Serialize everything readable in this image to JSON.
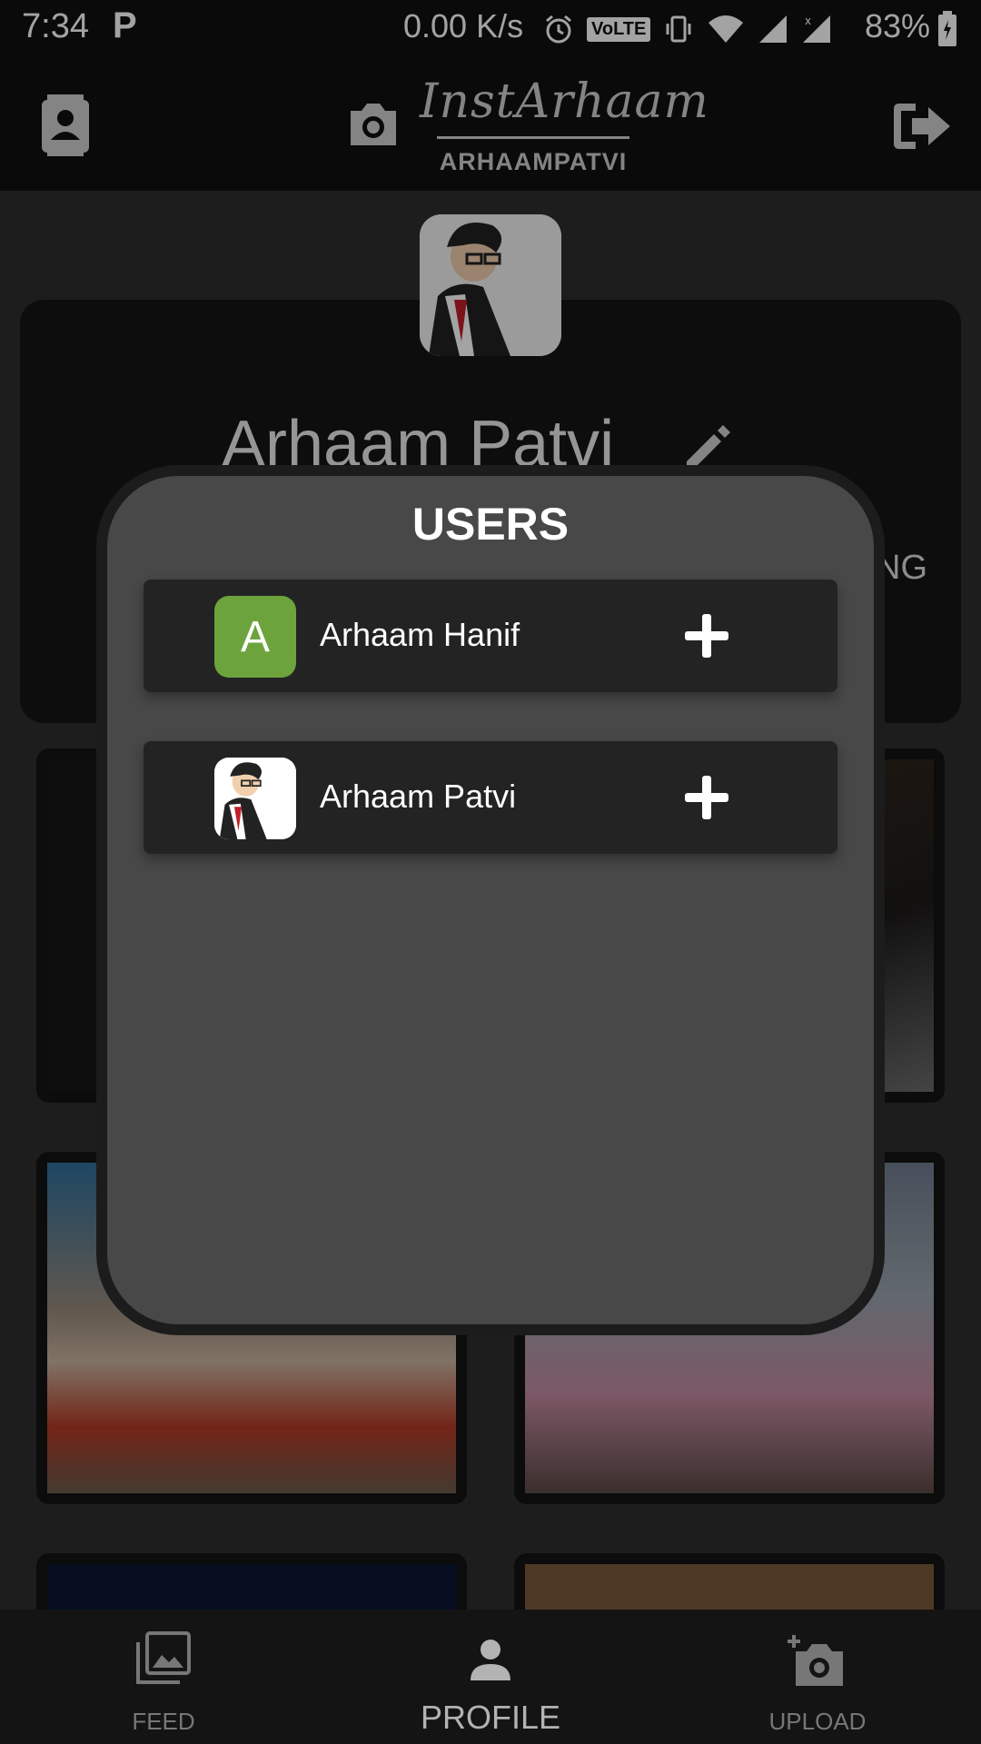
{
  "status_bar": {
    "time": "7:34",
    "notification_icon": "P",
    "net_speed": "0.00 K/s",
    "volte": "VoLTE",
    "battery": "83%",
    "icons": [
      "alarm-icon",
      "volte-icon",
      "vibrate-icon",
      "wifi-icon",
      "signal-icon",
      "signal-icon",
      "battery-icon"
    ]
  },
  "header": {
    "brand": "InstArhaam",
    "username": "ARHAAMPATVI"
  },
  "profile": {
    "name": "Arhaam Patvi",
    "partial_stat_label": "NG"
  },
  "dialog": {
    "title": "USERS",
    "users": [
      {
        "initial": "A",
        "name": "Arhaam Hanif",
        "avatar_color": "#6da33d"
      },
      {
        "initial": "",
        "name": "Arhaam Patvi",
        "avatar_color": "#ffffff"
      }
    ]
  },
  "bottom_nav": {
    "items": [
      {
        "label": "FEED",
        "icon": "image-gallery-icon"
      },
      {
        "label": "PROFILE",
        "icon": "person-icon"
      },
      {
        "label": "UPLOAD",
        "icon": "add-camera-icon"
      }
    ],
    "active": "PROFILE"
  },
  "colors": {
    "dialog_bg": "#484848",
    "row_bg": "#232323",
    "accent_green": "#6da33d",
    "header_bg": "#111111"
  }
}
